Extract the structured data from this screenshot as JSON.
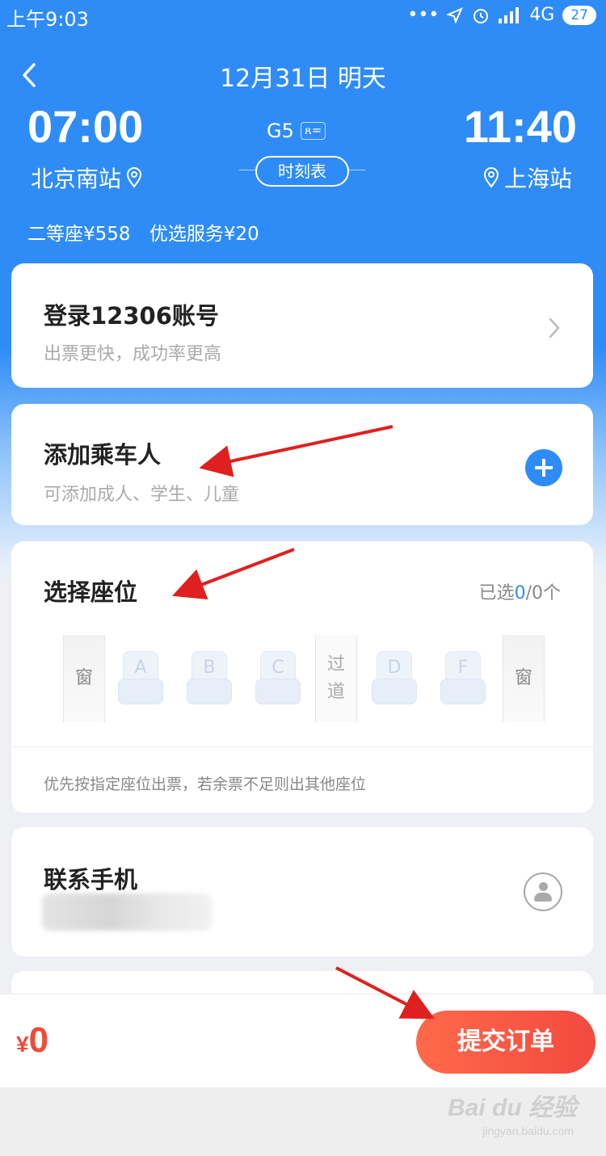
{
  "status_bar": {
    "time": "上午9:03",
    "network": "4G",
    "battery": "27"
  },
  "header": {
    "date": "12月31日 明天"
  },
  "trip": {
    "departure_time": "07:00",
    "arrival_time": "11:40",
    "departure_station": "北京南站",
    "arrival_station": "上海站",
    "train_number": "G5",
    "timetable_label": "时刻表",
    "seat_price": "二等座¥558",
    "service_price": "优选服务¥20"
  },
  "login": {
    "title": "登录12306账号",
    "subtitle": "出票更快，成功率更高"
  },
  "passenger": {
    "title": "添加乘车人",
    "subtitle": "可添加成人、学生、儿童"
  },
  "seats": {
    "title": "选择座位",
    "count_prefix": "已选",
    "count_selected": "0",
    "count_suffix": "/0个",
    "window_label": "窗",
    "aisle_label_1": "过",
    "aisle_label_2": "道",
    "seat_letters": [
      "A",
      "B",
      "C",
      "D",
      "F"
    ],
    "note": "优先按指定座位出票，若余票不足则出其他座位"
  },
  "contact": {
    "title": "联系手机"
  },
  "footer": {
    "total": "¥0",
    "currency": "¥",
    "amount": "0",
    "submit_label": "提交订单"
  },
  "watermark": {
    "brand": "Bai du 经验",
    "url": "jingyan.baidu.com"
  },
  "colors": {
    "primary": "#2f8cf6",
    "accent": "#f04a3b",
    "arrow": "#e02020"
  }
}
